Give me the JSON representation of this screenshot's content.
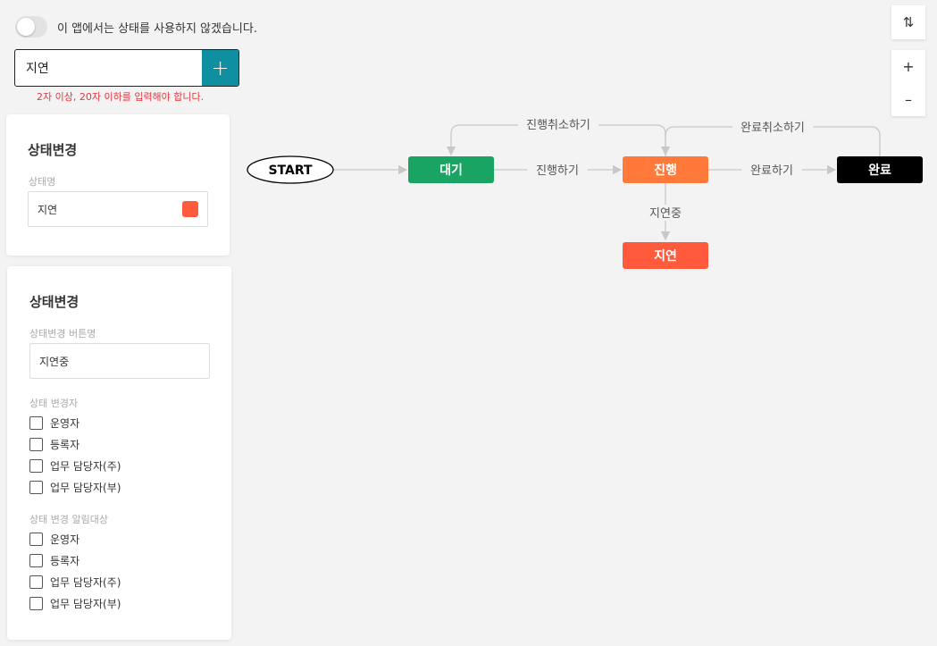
{
  "top": {
    "toggle_label": "이 앱에서는 상태를 사용하지 않겠습니다.",
    "input_value": "지연",
    "error_text": "2자 이상, 20자 이하를 입력해야 합니다."
  },
  "panel_status": {
    "title": "상태변경",
    "name_label": "상태명",
    "name_value": "지연",
    "color": "#ff5a3c"
  },
  "panel_change": {
    "title": "상태변경",
    "button_name_label": "상태변경 버튼명",
    "button_name_value": "지연중",
    "changer_label": "상태 변경자",
    "changers": [
      "운영자",
      "등록자",
      "업무 담당자(주)",
      "업무 담당자(부)"
    ],
    "notify_label": "상태 변경 알림대상",
    "notify": [
      "운영자",
      "등록자",
      "업무 담당자(주)",
      "업무 담당자(부)"
    ]
  },
  "flow": {
    "nodes": {
      "start": "START",
      "wait": "대기",
      "progress": "진행",
      "done": "완료",
      "delay": "지연"
    },
    "edges": {
      "to_progress": "진행하기",
      "cancel_progress": "진행취소하기",
      "to_done": "완료하기",
      "cancel_done": "완료취소하기",
      "to_delay": "지연중"
    },
    "colors": {
      "wait": "#1aa463",
      "progress": "#ff7a3a",
      "done": "#000000",
      "delay": "#ff5a3c"
    }
  },
  "controls": {
    "sort_icon": "sort-arrows-icon",
    "zoom_in": "+",
    "zoom_out": "–"
  }
}
